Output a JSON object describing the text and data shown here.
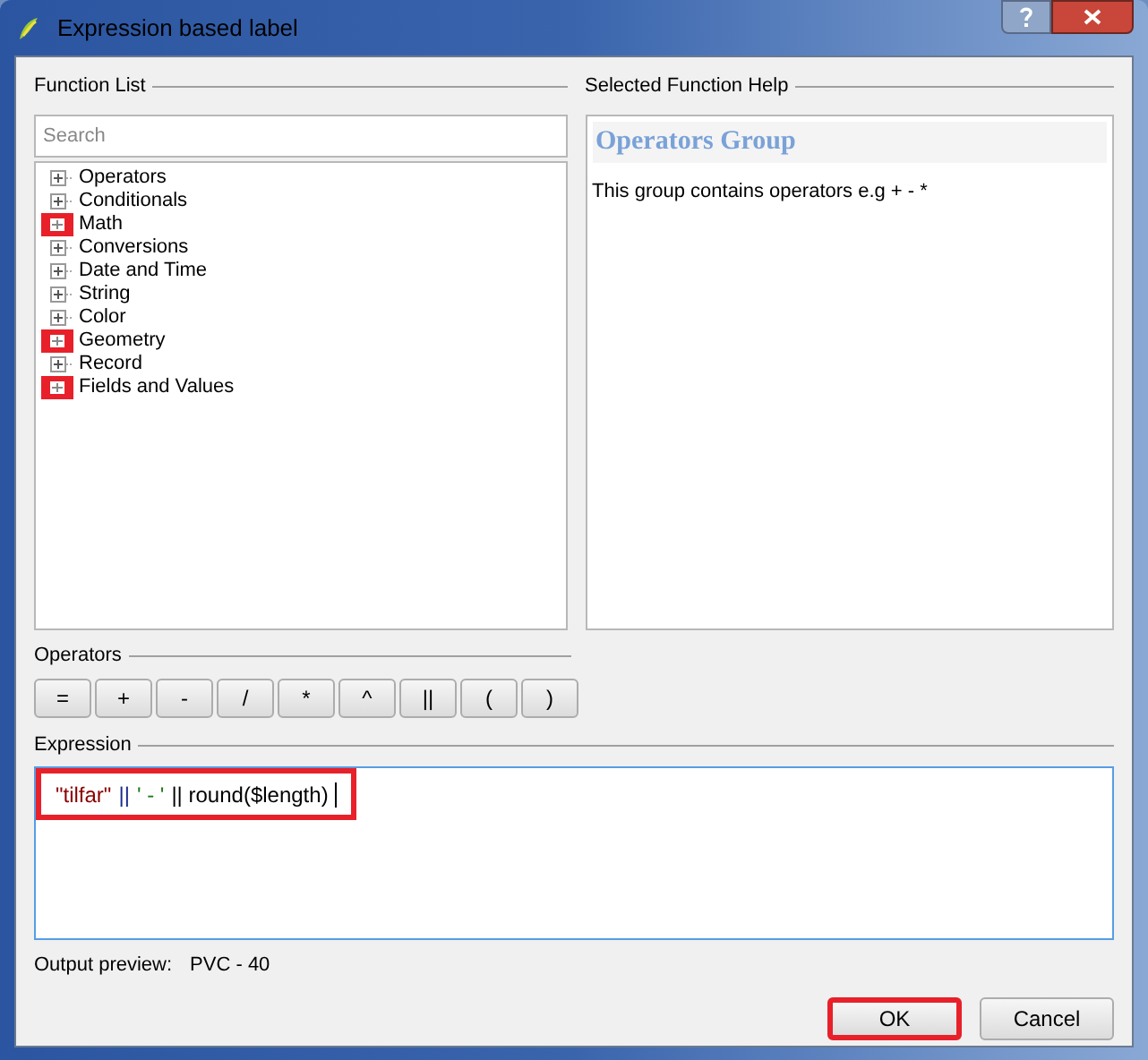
{
  "window": {
    "title": "Expression based label"
  },
  "function_list": {
    "title": "Function List",
    "search": {
      "placeholder": "Search"
    },
    "items": [
      {
        "label": "Operators",
        "highlighted": false
      },
      {
        "label": "Conditionals",
        "highlighted": false
      },
      {
        "label": "Math",
        "highlighted": true
      },
      {
        "label": "Conversions",
        "highlighted": false
      },
      {
        "label": "Date and Time",
        "highlighted": false
      },
      {
        "label": "String",
        "highlighted": false
      },
      {
        "label": "Color",
        "highlighted": false
      },
      {
        "label": "Geometry",
        "highlighted": true
      },
      {
        "label": "Record",
        "highlighted": false
      },
      {
        "label": "Fields and Values",
        "highlighted": true
      }
    ]
  },
  "help": {
    "title": "Selected Function Help",
    "heading": "Operators Group",
    "text": "This group contains operators e.g + - *"
  },
  "operators": {
    "title": "Operators",
    "buttons": [
      "=",
      "+",
      "-",
      "/",
      "*",
      "^",
      "||",
      "(",
      ")"
    ]
  },
  "expression": {
    "title": "Expression",
    "highlighted": true,
    "tokens": [
      {
        "text": "\"tilfar\"",
        "kind": "string"
      },
      {
        "text": "||",
        "kind": "operator"
      },
      {
        "text": "' - '",
        "kind": "literal"
      },
      {
        "text": "|| round($length)",
        "kind": "plain"
      }
    ]
  },
  "output_preview": {
    "label": "Output preview:",
    "value": "PVC - 40"
  },
  "buttons": [
    {
      "label": "OK",
      "highlighted": true
    },
    {
      "label": "Cancel",
      "highlighted": false
    }
  ]
}
